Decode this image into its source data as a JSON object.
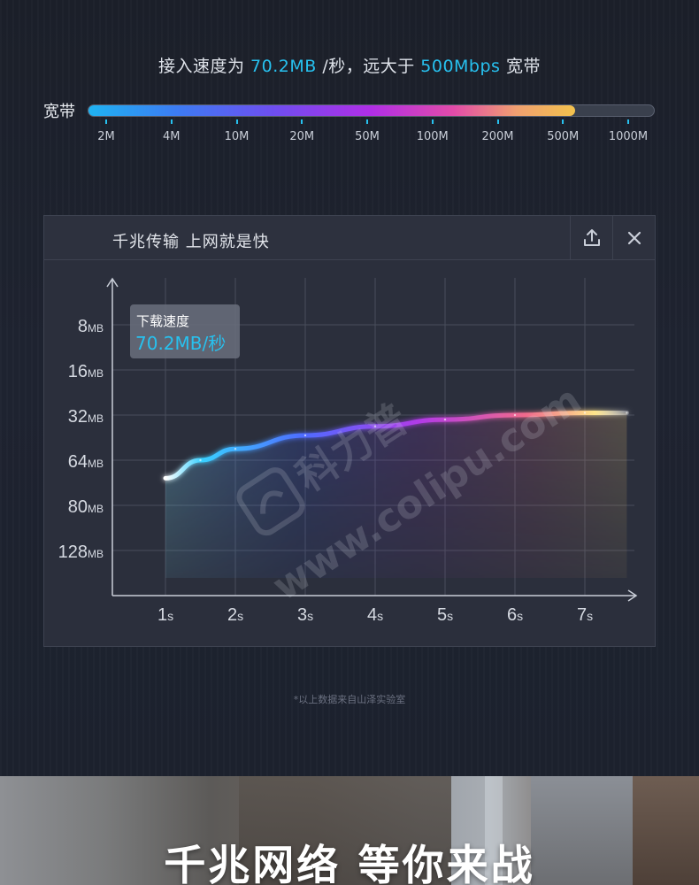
{
  "headline": {
    "prefix": "接入速度为 ",
    "speed": "70.2MB",
    "middle": " /秒，远大于 ",
    "bandwidth": "500Mbps",
    "suffix": " 宽带"
  },
  "bandwidth_bar": {
    "label": "宽带",
    "fill_fraction": 0.86,
    "ticks": [
      "2M",
      "4M",
      "10M",
      "20M",
      "50M",
      "100M",
      "200M",
      "500M",
      "1000M"
    ]
  },
  "panel": {
    "title": "千兆传输  上网就是快",
    "share_icon": "upload-share-icon",
    "close_icon": "close-icon"
  },
  "chart_data": {
    "type": "line",
    "y_ticks": [
      {
        "value": "128",
        "unit": "MB"
      },
      {
        "value": "80",
        "unit": "MB"
      },
      {
        "value": "64",
        "unit": "MB"
      },
      {
        "value": "32",
        "unit": "MB"
      },
      {
        "value": "16",
        "unit": "MB"
      },
      {
        "value": "8",
        "unit": "MB"
      }
    ],
    "x_ticks": [
      {
        "value": "1",
        "unit": "s"
      },
      {
        "value": "2",
        "unit": "s"
      },
      {
        "value": "3",
        "unit": "s"
      },
      {
        "value": "4",
        "unit": "s"
      },
      {
        "value": "5",
        "unit": "s"
      },
      {
        "value": "6",
        "unit": "s"
      },
      {
        "value": "7",
        "unit": "s"
      }
    ],
    "series": [
      {
        "x": [
          1,
          1.5,
          2,
          3,
          4,
          5,
          6,
          7,
          7.6
        ],
        "y_level": [
          2.6,
          3.0,
          3.25,
          3.55,
          3.75,
          3.9,
          4.0,
          4.05,
          4.05
        ]
      }
    ],
    "callout": {
      "label": "下载速度",
      "value": "70.2MB/秒"
    }
  },
  "watermark": {
    "brand": "科力普",
    "url": "www.colipu.com"
  },
  "footnote": "*以上数据来自山泽实验室",
  "bottom_banner": {
    "title": "千兆网络 等你来战"
  },
  "colors": {
    "accent": "#27c1ef",
    "panel": "#2b2f3c",
    "bg": "#1e2330"
  }
}
